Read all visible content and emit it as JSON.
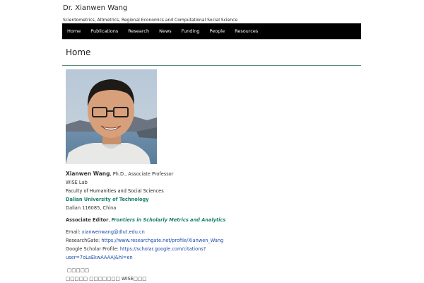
{
  "site": {
    "title": "Dr. Xianwen Wang",
    "description": "Scientometrics, Altmetrics, Regional Economics and Computational Social Science"
  },
  "nav": {
    "items": [
      "Home",
      "Publications",
      "Research",
      "News",
      "Funding",
      "People",
      "Resources"
    ]
  },
  "page": {
    "title": "Home"
  },
  "profile": {
    "name": "Xianwen Wang",
    "title_suffix": ", Ph.D., Associate Professor",
    "lab": "WISE Lab",
    "faculty": "Faculty of Humanities and Social Sciences",
    "university": "Dalian University of Technology",
    "address": "Dalian 116085, China",
    "editor_label": "Associate Editor",
    "editor_sep": ", ",
    "journal": "Frontiers in Scholarly Metrics and Analytics",
    "email_label": "Email: ",
    "email": "xianwenwang@dlut.edu.cn",
    "rg_label": "ResearchGate: ",
    "rg_url": "https://www.researchgate.net/profile/Xianwen_Wang",
    "gs_label": "Google Scholar Profile: ",
    "gs_url_1": "https://scholar.google.com/citations?",
    "gs_url_2": "user=7oLaEkwAAAAJ&hl=en",
    "cn_line_1": "□□□□□",
    "cn_line_2": "□□□□□ □□□□□□□ WISE□□□"
  },
  "colors": {
    "nav_bg": "#000000",
    "accent": "#1a7f6e",
    "link": "#1a4aa8",
    "rule": "#5a8a79"
  }
}
